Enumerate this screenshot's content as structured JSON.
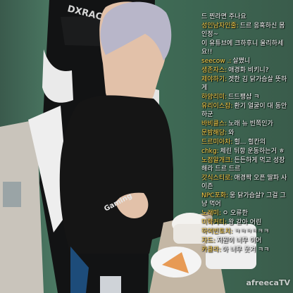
{
  "chat": {
    "messages": [
      {
        "nick": "",
        "text": "드 찐라면 주나요"
      },
      {
        "nick": "성인남자인줄:",
        "text": "드르 응혹하신 몸 인정~"
      },
      {
        "nick": "",
        "text": "이 유튜브에 크하후니 울리하세요!!"
      },
      {
        "nick": "seecow .:",
        "text": "살쪘니"
      },
      {
        "nick": "생존자스:",
        "text": "애경화 비키니?"
      },
      {
        "nick": "제야하기:",
        "text": "겟한 김 닭가슴살 뜻하게"
      },
      {
        "nick": "하양리미:",
        "text": "드드팽샵 ㅋ"
      },
      {
        "nick": "유리이스잡:",
        "text": "환기 얼굴이 대 동안하군"
      },
      {
        "nick": "바비클스:",
        "text": "노래 뉴 빈쪽인가"
      },
      {
        "nick": "문밤해당:",
        "text": "와"
      },
      {
        "nick": "드르미아차:",
        "text": "헐... 헐칸의"
      },
      {
        "nick": "chkg:",
        "text": "체린 뒤항 운동하는거 ㅎ"
      },
      {
        "nick": "노점알개크:",
        "text": "든든하게 먹고 성장해라 드르 드르"
      },
      {
        "nick": "갓식스티로:",
        "text": "애경짝 오픈 딸파 사이즌"
      },
      {
        "nick": "NPC포화:",
        "text": "웅 닭가슴살? 그걸 그냥 먹어"
      },
      {
        "nick": "노래미:",
        "text": "ㅇ 오류한"
      },
      {
        "nick": "미학커티:",
        "text": "왕 같아 어린"
      },
      {
        "nick": "하여빈토치:",
        "text": "ㅋㅋㅋㅋㅋㅋ"
      },
      {
        "nick": "자드:",
        "text": "저원이 너무 이어"
      },
      {
        "nick": "카클라:",
        "text": "아 너무 웃겨 ㅋㅋ"
      }
    ]
  },
  "chair": {
    "brand": "DXRACER"
  },
  "shirt": {
    "text": "Gaming"
  },
  "broadcast": {
    "logo": "afreecaTV"
  }
}
